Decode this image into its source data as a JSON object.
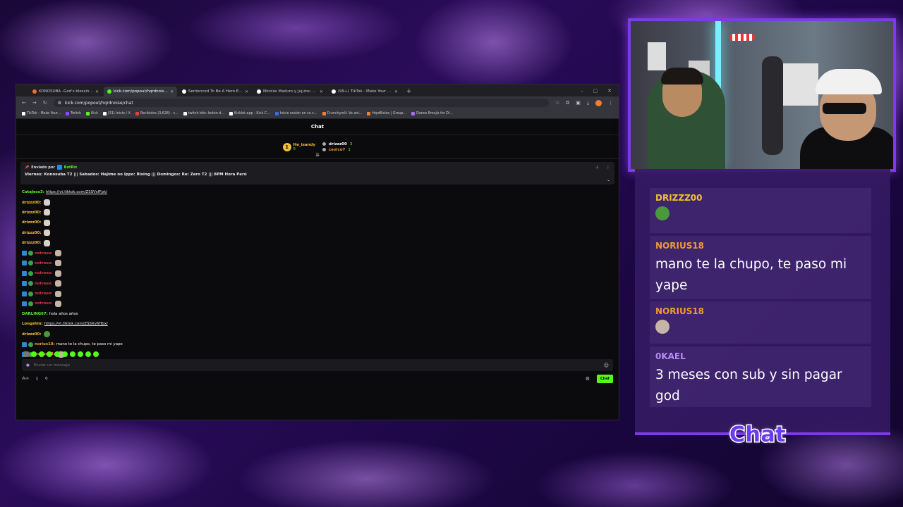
{
  "browser": {
    "tabs": [
      {
        "label": "KONOSUBA -God's blessing on",
        "color": "#f07030",
        "active": false
      },
      {
        "label": "kick.com/popout/hqrdnoise/ch",
        "color": "#53fc18",
        "active": true
      },
      {
        "label": "Sentenced To Be A Hero Episo",
        "color": "#ffffff",
        "active": false
      },
      {
        "label": "Nicolás Maduro y Jujutsu Kaise",
        "color": "#ffffff",
        "active": false
      },
      {
        "label": "(99+) TikTok - Make Your Day",
        "color": "#ffffff",
        "active": false
      }
    ],
    "new_tab": "+",
    "url": "kick.com/popout/hqrdnoise/chat",
    "bookmarks": [
      {
        "label": "TikTok - Make Your...",
        "color": "#ffffff"
      },
      {
        "label": "Twitch",
        "color": "#9146ff"
      },
      {
        "label": "Kick",
        "color": "#53fc18"
      },
      {
        "label": "(31) Inicio / X",
        "color": "#ffffff"
      },
      {
        "label": "Recibidos (3,628) - c...",
        "color": "#e04040"
      },
      {
        "label": "twitch bits: botón d...",
        "color": "#ffffff"
      },
      {
        "label": "Kicklet.app - Kick C...",
        "color": "#ffffff"
      },
      {
        "label": "Inicie sesión en su c...",
        "color": "#3070e0"
      },
      {
        "label": "Crunchyroll: Ve ani...",
        "color": "#f08030"
      },
      {
        "label": "HqrdNoise | Group...",
        "color": "#f08030"
      },
      {
        "label": "Dance Emojis for Di...",
        "color": "#a070f0"
      }
    ]
  },
  "kick": {
    "header": "Chat",
    "top_gifter": {
      "name": "He_isandy",
      "count": "5"
    },
    "gifters": [
      {
        "name": "drizzz00",
        "count": "3"
      },
      {
        "name": "cevico7",
        "count": "1"
      }
    ],
    "pinned": {
      "by_label": "Enviado por",
      "by_user": "BotRix",
      "message": "Viernes: Konosuba T2 ||| Sabados: Hajime no Ippo: Rising ||| Domingos: Re: Zero T2 ||| 8PM Hora Perú"
    },
    "messages": [
      {
        "user": "CotaJess3:",
        "cls": "u-green",
        "text": "https://vt.tiktok.com/ZSSVsfFpk/",
        "link": true,
        "emote": ""
      },
      {
        "user": "drizzz00:",
        "cls": "u-yellow",
        "text": "",
        "link": false,
        "emote": "emote"
      },
      {
        "user": "drizzz00:",
        "cls": "u-yellow",
        "text": "",
        "link": false,
        "emote": "emote"
      },
      {
        "user": "drizzz00:",
        "cls": "u-yellow",
        "text": "",
        "link": false,
        "emote": "emote"
      },
      {
        "user": "drizzz00:",
        "cls": "u-yellow",
        "text": "",
        "link": false,
        "emote": "emote"
      },
      {
        "user": "drizzz00:",
        "cls": "u-yellow",
        "text": "",
        "link": false,
        "emote": "emote"
      },
      {
        "user": "notrees:",
        "cls": "u-red",
        "text": "",
        "link": false,
        "emote": "emote cat",
        "badges": true
      },
      {
        "user": "notrees:",
        "cls": "u-red",
        "text": "",
        "link": false,
        "emote": "emote cat",
        "badges": true
      },
      {
        "user": "notrees:",
        "cls": "u-red",
        "text": "",
        "link": false,
        "emote": "emote cat",
        "badges": true
      },
      {
        "user": "notrees:",
        "cls": "u-red",
        "text": "",
        "link": false,
        "emote": "emote cat",
        "badges": true
      },
      {
        "user": "notrees:",
        "cls": "u-red",
        "text": "",
        "link": false,
        "emote": "emote cat",
        "badges": true
      },
      {
        "user": "notrees:",
        "cls": "u-red",
        "text": "",
        "link": false,
        "emote": "emote cat",
        "badges": true
      },
      {
        "user": "DARLING67:",
        "cls": "u-green",
        "text": "hola años años",
        "link": false,
        "emote": ""
      },
      {
        "user": "Longshin:",
        "cls": "u-yellow",
        "text": "https://vt.tiktok.com/ZSSXv6Hbx/",
        "link": true,
        "emote": ""
      },
      {
        "user": "drizzz00:",
        "cls": "u-yellow",
        "text": "",
        "link": false,
        "emote": "emote pepe"
      },
      {
        "user": "norius18:",
        "cls": "u-orange",
        "text": "mano te la chupo, te paso mi yape",
        "link": false,
        "emote": "",
        "badges": true
      },
      {
        "user": "norius18:",
        "cls": "u-orange",
        "text": "",
        "link": false,
        "emote": "emote cat",
        "badges": true
      },
      {
        "user": "0Kael:",
        "cls": "u-purple",
        "text": "3 meses con sub y sin pagar god",
        "link": false,
        "emote": ""
      }
    ],
    "input_placeholder": "Enviar un mensaje",
    "viewer_count": "0",
    "chat_button": "Chat"
  },
  "overlay": {
    "messages": [
      {
        "user": "DRIZZZ00",
        "color": "#f2c230",
        "text": "",
        "emote": "#4a9a3c"
      },
      {
        "user": "NORIUS18",
        "color": "#f09a30",
        "text": "mano te la chupo, te paso mi yape",
        "emote": ""
      },
      {
        "user": "NORIUS18",
        "color": "#f09a30",
        "text": "",
        "emote": "#c7b4a8"
      },
      {
        "user": "0KAEL",
        "color": "#b48cf0",
        "text": "3 meses con sub y sin pagar god",
        "emote": ""
      }
    ],
    "title": "Chat"
  }
}
